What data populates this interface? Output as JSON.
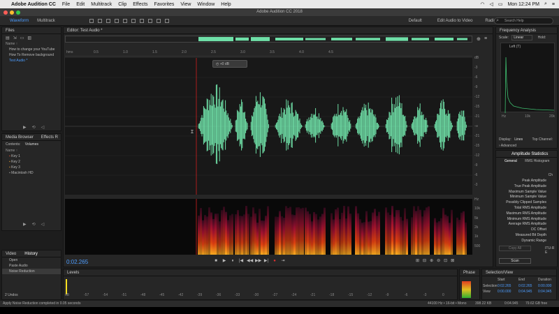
{
  "mac_menu": {
    "app": "Adobe Audition CC",
    "items": [
      "File",
      "Edit",
      "Multitrack",
      "Clip",
      "Effects",
      "Favorites",
      "View",
      "Window",
      "Help"
    ],
    "time": "Mon 12:24 PM"
  },
  "window": {
    "title": "Adobe Audition CC 2018"
  },
  "toolbar": {
    "waveform": "Waveform",
    "multitrack": "Multitrack",
    "workspaces": [
      "Default",
      "Edit Audio to Video",
      "Radio Production"
    ],
    "search_placeholder": "Search Help"
  },
  "files_panel": {
    "title": "Files",
    "header": "Name ↑",
    "items": [
      "How to change your YouTube",
      "How To Remove background",
      "Test Audio *"
    ]
  },
  "media_browser": {
    "tab1": "Media Browser",
    "tab2": "Effects R",
    "sub1": "Contents:",
    "sub2": "Volumes",
    "header": "Name ↑",
    "items": [
      "Key 1",
      "Key 2",
      "Key 3",
      "Macintosh HD"
    ]
  },
  "history": {
    "tab1": "Video",
    "tab2": "History",
    "items": [
      "Open",
      "Paste Audio",
      "Noise Reduction"
    ],
    "undos": "2 Undos"
  },
  "editor": {
    "title": "Editor: Test Audio *",
    "hms": "hms",
    "time_ticks": [
      "0.5",
      "1.0",
      "1.5",
      "2.0",
      "2.5",
      "3.0",
      "3.5",
      "4.0",
      "4.5"
    ],
    "db_ticks": [
      "dB",
      "-3",
      "-6",
      "-9",
      "-12",
      "-15",
      "-21",
      "-∞",
      "-21",
      "-15",
      "-12",
      "-9",
      "-6",
      "-3"
    ],
    "hz_ticks": [
      "Hz",
      "10k",
      "5k",
      "2k",
      "1k",
      "500"
    ],
    "gain": "+0 dB",
    "current_time": "0:02.265"
  },
  "transport": [
    "■",
    "▶",
    "⏸",
    "|◀",
    "◀◀",
    "▶▶",
    "▶|",
    "●",
    "⇥"
  ],
  "levels": {
    "title": "Levels",
    "ticks": [
      "dB",
      "-57",
      "-54",
      "-51",
      "-48",
      "-45",
      "-42",
      "-39",
      "-36",
      "-33",
      "-30",
      "-27",
      "-24",
      "-21",
      "-18",
      "-15",
      "-12",
      "-9",
      "-6",
      "-3",
      "0"
    ]
  },
  "phase": {
    "title": "Phase"
  },
  "selection_view": {
    "title": "Selection/View",
    "cols": [
      "Start",
      "End",
      "Duration"
    ],
    "rows": [
      {
        "label": "Selection",
        "start": "0:02.265",
        "end": "0:02.265",
        "duration": "0:00.000"
      },
      {
        "label": "View",
        "start": "0:00.000",
        "end": "0:04.945",
        "duration": "0:04.945"
      }
    ]
  },
  "frequency": {
    "title": "Frequency Analysis",
    "scale_label": "Scale:",
    "scale": "Linear",
    "hold": "Hold:",
    "left_ch": "Left (T)",
    "x_ticks": [
      "Hz",
      "10k",
      "20k"
    ],
    "display_label": "Display:",
    "display": "Lines",
    "top_channel": "Top Channel:",
    "advanced": "Advanced"
  },
  "amplitude": {
    "title": "Amplitude Statistics",
    "tab_general": "General",
    "tab_rms": "RMS Histogram",
    "ch": "Ch",
    "stats": [
      "Peak Amplitude",
      "True Peak Amplitude",
      "Maximum Sample Value",
      "Minimum Sample Value",
      "Possibly Clipped Samples",
      "Total RMS Amplitude",
      "Maximum RMS Amplitude",
      "Minimum RMS Amplitude",
      "Average RMS Amplitude",
      "DC Offset",
      "Measured Bit Depth",
      "Dynamic Range"
    ],
    "copy_all": "Copy All",
    "itu": "ITU-R E",
    "scan": "Scan"
  },
  "status": {
    "left": "Apply Noise Reduction completed in 0.05 seconds",
    "format": "44100 Hz • 16-bit • Mono",
    "size": "398.22 KB",
    "dur": "0:04.945",
    "free": "79.62 GB free"
  },
  "colors": {
    "accent": "#4d9dff",
    "wave": "#6fe0a8",
    "playhead": "#d02020"
  }
}
